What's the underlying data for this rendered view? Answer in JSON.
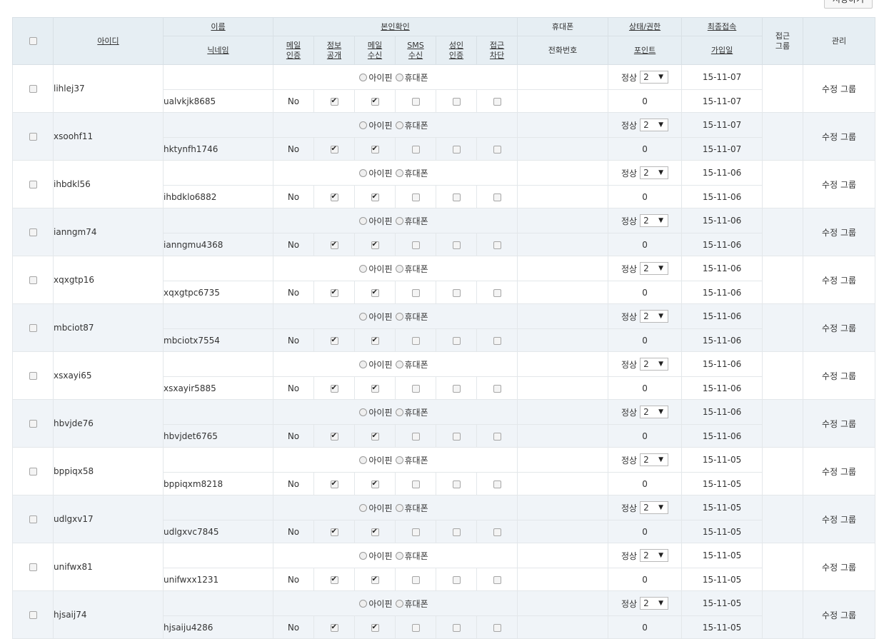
{
  "toolbar": {
    "top_button_label": "저장하기"
  },
  "header": {
    "row1": {
      "id": "아이디",
      "name": "이름",
      "verification": "본인확인",
      "phone": "휴대폰",
      "status_perm": "상태/권한",
      "last_login": "최종접속",
      "access_group": "접근 그룹",
      "manage": "관리"
    },
    "row2": {
      "nickname": "닉네임",
      "email_verify": "메일 인증",
      "info_open": "정보 공개",
      "mail_recv": "메일 수신",
      "sms_recv": "SMS 수신",
      "adult_verify": "성인 인증",
      "access_block": "접근 차단",
      "phone_number": "전화번호",
      "points": "포인트",
      "join_date": "가입일"
    }
  },
  "cert_options": {
    "ipin": "아이핀",
    "phone": "휴대폰"
  },
  "status_label": "정상",
  "level_value": "2",
  "manage_links": {
    "edit": "수정",
    "group": "그룹"
  },
  "members": [
    {
      "id": "lihlej37",
      "nickname": "ualvkjk8685",
      "email_verify": "No",
      "info_open": true,
      "mail_recv": true,
      "sms_recv": false,
      "adult_verify": false,
      "access_block": false,
      "points": "0",
      "last_login": "15-11-07",
      "join_date": "15-11-07"
    },
    {
      "id": "xsoohf11",
      "nickname": "hktynfh1746",
      "email_verify": "No",
      "info_open": true,
      "mail_recv": true,
      "sms_recv": false,
      "adult_verify": false,
      "access_block": false,
      "points": "0",
      "last_login": "15-11-07",
      "join_date": "15-11-07"
    },
    {
      "id": "ihbdkl56",
      "nickname": "ihbdklo6882",
      "email_verify": "No",
      "info_open": true,
      "mail_recv": true,
      "sms_recv": false,
      "adult_verify": false,
      "access_block": false,
      "points": "0",
      "last_login": "15-11-06",
      "join_date": "15-11-06"
    },
    {
      "id": "ianngm74",
      "nickname": "ianngmu4368",
      "email_verify": "No",
      "info_open": true,
      "mail_recv": true,
      "sms_recv": false,
      "adult_verify": false,
      "access_block": false,
      "points": "0",
      "last_login": "15-11-06",
      "join_date": "15-11-06"
    },
    {
      "id": "xqxgtp16",
      "nickname": "xqxgtpc6735",
      "email_verify": "No",
      "info_open": true,
      "mail_recv": true,
      "sms_recv": false,
      "adult_verify": false,
      "access_block": false,
      "points": "0",
      "last_login": "15-11-06",
      "join_date": "15-11-06"
    },
    {
      "id": "mbciot87",
      "nickname": "mbciotx7554",
      "email_verify": "No",
      "info_open": true,
      "mail_recv": true,
      "sms_recv": false,
      "adult_verify": false,
      "access_block": false,
      "points": "0",
      "last_login": "15-11-06",
      "join_date": "15-11-06"
    },
    {
      "id": "xsxayi65",
      "nickname": "xsxayir5885",
      "email_verify": "No",
      "info_open": true,
      "mail_recv": true,
      "sms_recv": false,
      "adult_verify": false,
      "access_block": false,
      "points": "0",
      "last_login": "15-11-06",
      "join_date": "15-11-06"
    },
    {
      "id": "hbvjde76",
      "nickname": "hbvjdet6765",
      "email_verify": "No",
      "info_open": true,
      "mail_recv": true,
      "sms_recv": false,
      "adult_verify": false,
      "access_block": false,
      "points": "0",
      "last_login": "15-11-06",
      "join_date": "15-11-06"
    },
    {
      "id": "bppiqx58",
      "nickname": "bppiqxm8218",
      "email_verify": "No",
      "info_open": true,
      "mail_recv": true,
      "sms_recv": false,
      "adult_verify": false,
      "access_block": false,
      "points": "0",
      "last_login": "15-11-05",
      "join_date": "15-11-05"
    },
    {
      "id": "udlgxv17",
      "nickname": "udlgxvc7845",
      "email_verify": "No",
      "info_open": true,
      "mail_recv": true,
      "sms_recv": false,
      "adult_verify": false,
      "access_block": false,
      "points": "0",
      "last_login": "15-11-05",
      "join_date": "15-11-05"
    },
    {
      "id": "unifwx81",
      "nickname": "unifwxx1231",
      "email_verify": "No",
      "info_open": true,
      "mail_recv": true,
      "sms_recv": false,
      "adult_verify": false,
      "access_block": false,
      "points": "0",
      "last_login": "15-11-05",
      "join_date": "15-11-05"
    },
    {
      "id": "hjsaij74",
      "nickname": "hjsaiju4286",
      "email_verify": "No",
      "info_open": true,
      "mail_recv": true,
      "sms_recv": false,
      "adult_verify": false,
      "access_block": false,
      "points": "0",
      "last_login": "15-11-05",
      "join_date": "15-11-05"
    }
  ]
}
